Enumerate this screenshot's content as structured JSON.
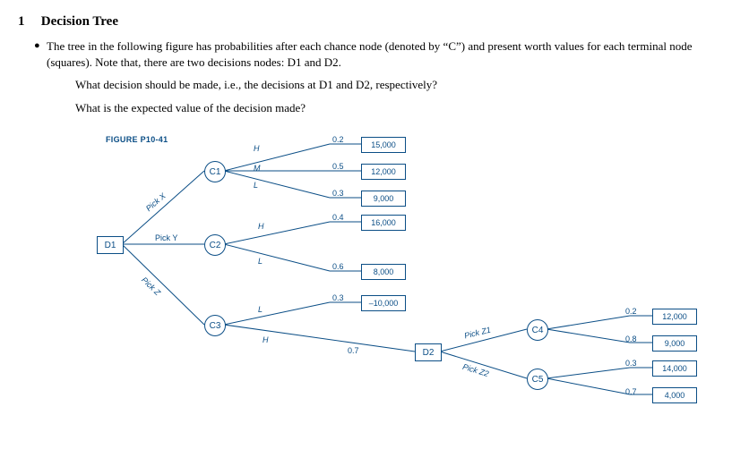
{
  "heading": {
    "number": "1",
    "title": "Decision Tree"
  },
  "intro": "The tree in the following figure has probabilities after each chance node (denoted by “C”) and present worth values for each terminal node (squares). Note that, there are two decisions nodes: D1 and D2.",
  "q1": "What decision should be made, i.e., the decisions at D1 and D2, respectively?",
  "q2": "What is the expected value of the decision made?",
  "fig": {
    "title": "FIGURE P10-41",
    "decisions": {
      "d1": "D1",
      "d2": "D2"
    },
    "chances": {
      "c1": "C1",
      "c2": "C2",
      "c3": "C3",
      "c4": "C4",
      "c5": "C5"
    },
    "branches": {
      "pickX": "Pick X",
      "pickY": "Pick Y",
      "pickZ": "Pick Z",
      "pickZ1": "Pick Z1",
      "pickZ2": "Pick Z2",
      "H": "H",
      "M": "M",
      "L": "L"
    },
    "probs": {
      "c1H": "0.2",
      "c1M": "0.5",
      "c1L": "0.3",
      "c2H": "0.4",
      "c2L": "0.6",
      "c3L": "0.3",
      "c3H": "0.7",
      "c4a": "0.2",
      "c4b": "0.8",
      "c5a": "0.3",
      "c5b": "0.7"
    },
    "terminals": {
      "t1": "15,000",
      "t2": "12,000",
      "t3": "9,000",
      "t4": "16,000",
      "t5": "8,000",
      "t6": "–10,000",
      "t7": "12,000",
      "t8": "9,000",
      "t9": "14,000",
      "t10": "4,000"
    }
  }
}
